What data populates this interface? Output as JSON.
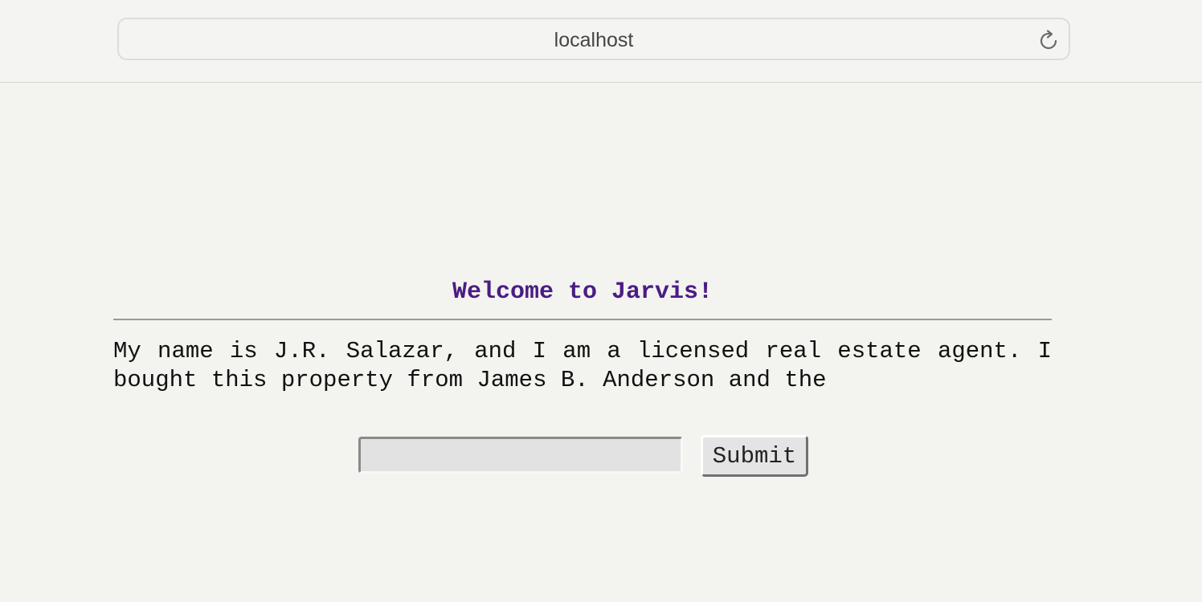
{
  "browser": {
    "url": "localhost",
    "reload_icon": "reload-icon"
  },
  "page": {
    "title": "Welcome to Jarvis!",
    "story": "My name is J.R. Salazar, and I am a licensed real estate agent. I bought this property from James B. Anderson and the",
    "answer_value": "",
    "submit_label": "Submit"
  },
  "colors": {
    "title": "#4b1c84",
    "background": "#f3f3ef",
    "text": "#111111"
  }
}
